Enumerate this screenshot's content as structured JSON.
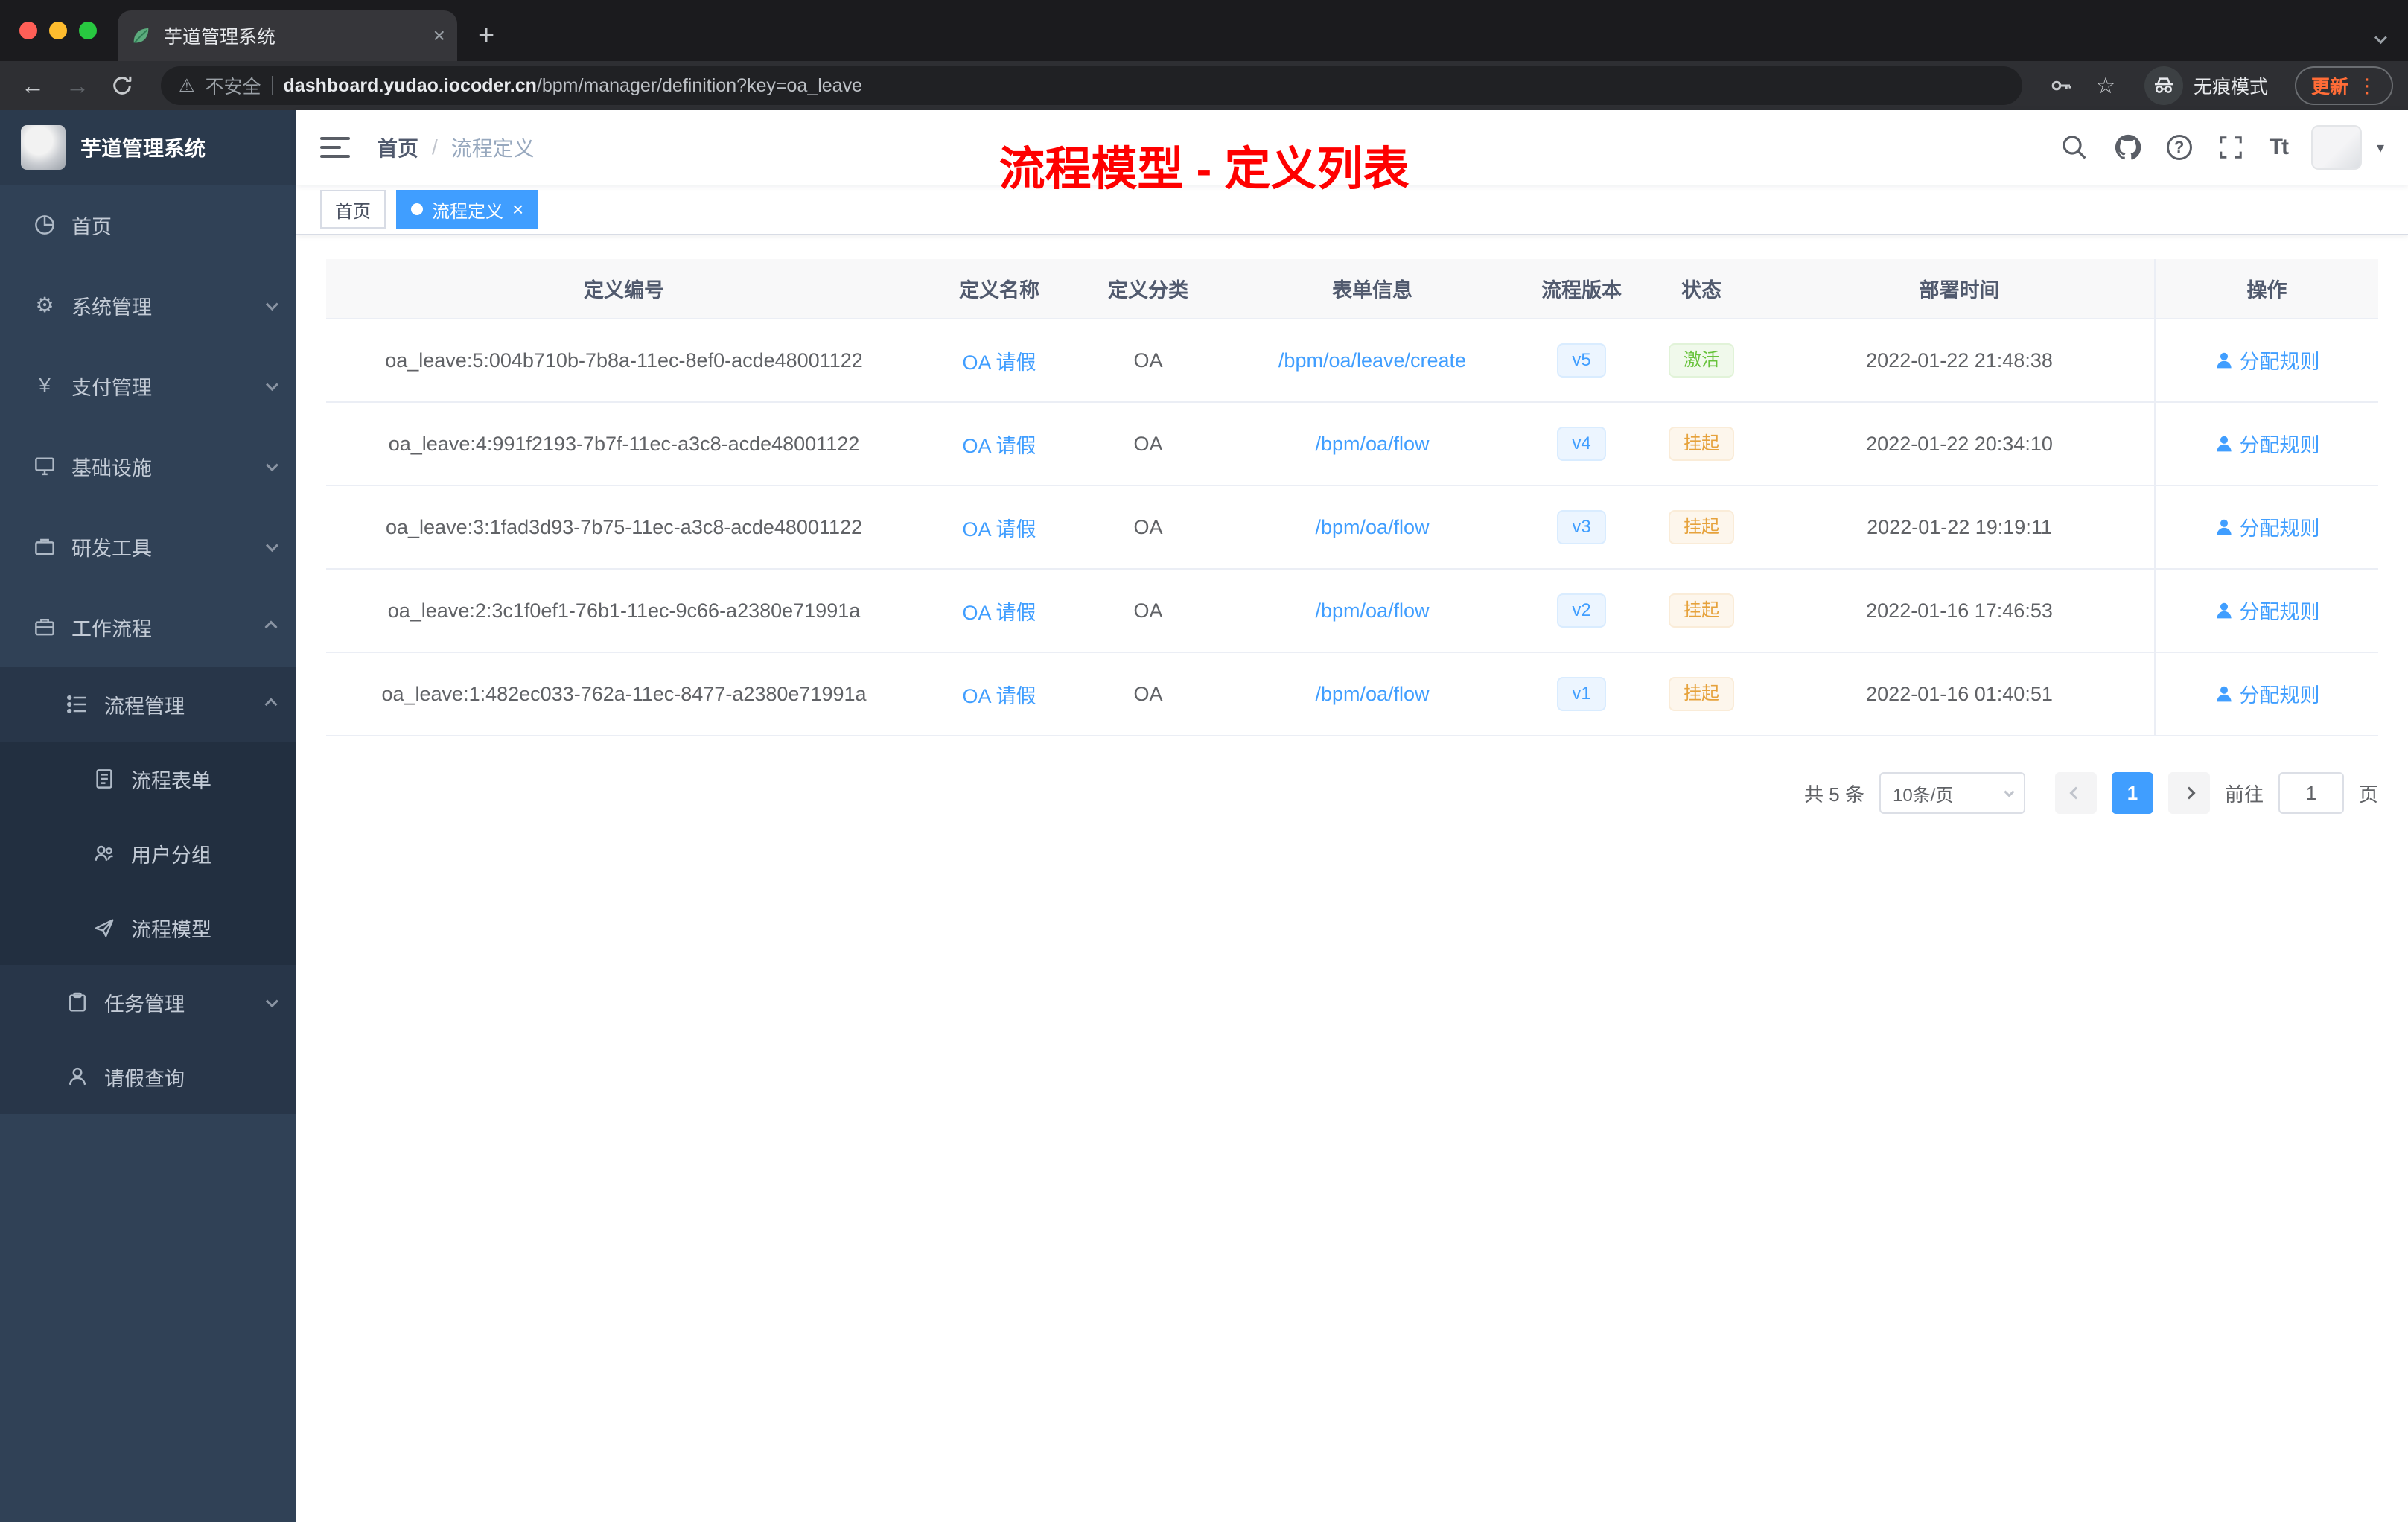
{
  "colors": {
    "accent": "#409eff",
    "success": "#67c23a",
    "warning": "#e6a23c",
    "annotation": "#fe0000",
    "update": "#ff6c37"
  },
  "icons": {
    "back": "←",
    "forward": "→",
    "warning": "⚠",
    "star": "☆",
    "menu_dots": "⋮",
    "new_tab": "+",
    "close_tab": "×",
    "gear": "⚙",
    "yen": "¥",
    "help": "?",
    "font_size": "Tt",
    "caret_down": "▾",
    "close_tag": "×"
  },
  "browser": {
    "tab_title": "芋道管理系统",
    "security_label": "不安全",
    "url_host": "dashboard.yudao.iocoder.cn",
    "url_path": "/bpm/manager/definition?key=oa_leave",
    "incognito_label": "无痕模式",
    "update_label": "更新"
  },
  "sidebar": {
    "logo_title": "芋道管理系统",
    "items": [
      {
        "label": "首页"
      },
      {
        "label": "系统管理"
      },
      {
        "label": "支付管理"
      },
      {
        "label": "基础设施"
      },
      {
        "label": "研发工具"
      },
      {
        "label": "工作流程"
      },
      {
        "label": "流程管理"
      },
      {
        "label": "流程表单"
      },
      {
        "label": "用户分组"
      },
      {
        "label": "流程模型"
      },
      {
        "label": "任务管理"
      },
      {
        "label": "请假查询"
      }
    ]
  },
  "header": {
    "breadcrumb": {
      "home": "首页",
      "separator": "/",
      "current": "流程定义"
    },
    "annotation": "流程模型 - 定义列表"
  },
  "tags": {
    "home": "首页",
    "active": "流程定义"
  },
  "table": {
    "columns": [
      "定义编号",
      "定义名称",
      "定义分类",
      "表单信息",
      "流程版本",
      "状态",
      "部署时间",
      "操作"
    ],
    "rows": [
      {
        "id": "oa_leave:5:004b710b-7b8a-11ec-8ef0-acde48001122",
        "name": "OA 请假",
        "category": "OA",
        "form": "/bpm/oa/leave/create",
        "version": "v5",
        "status": "激活",
        "status_type": "success",
        "deploy_time": "2022-01-22 21:48:38",
        "action": "分配规则"
      },
      {
        "id": "oa_leave:4:991f2193-7b7f-11ec-a3c8-acde48001122",
        "name": "OA 请假",
        "category": "OA",
        "form": "/bpm/oa/flow",
        "version": "v4",
        "status": "挂起",
        "status_type": "warning",
        "deploy_time": "2022-01-22 20:34:10",
        "action": "分配规则"
      },
      {
        "id": "oa_leave:3:1fad3d93-7b75-11ec-a3c8-acde48001122",
        "name": "OA 请假",
        "category": "OA",
        "form": "/bpm/oa/flow",
        "version": "v3",
        "status": "挂起",
        "status_type": "warning",
        "deploy_time": "2022-01-22 19:19:11",
        "action": "分配规则"
      },
      {
        "id": "oa_leave:2:3c1f0ef1-76b1-11ec-9c66-a2380e71991a",
        "name": "OA 请假",
        "category": "OA",
        "form": "/bpm/oa/flow",
        "version": "v2",
        "status": "挂起",
        "status_type": "warning",
        "deploy_time": "2022-01-16 17:46:53",
        "action": "分配规则"
      },
      {
        "id": "oa_leave:1:482ec033-762a-11ec-8477-a2380e71991a",
        "name": "OA 请假",
        "category": "OA",
        "form": "/bpm/oa/flow",
        "version": "v1",
        "status": "挂起",
        "status_type": "warning",
        "deploy_time": "2022-01-16 01:40:51",
        "action": "分配规则"
      }
    ]
  },
  "pagination": {
    "total": "共 5 条",
    "page_size": "10条/页",
    "page": "1",
    "goto": "前往",
    "unit": "页",
    "goto_value": "1"
  }
}
